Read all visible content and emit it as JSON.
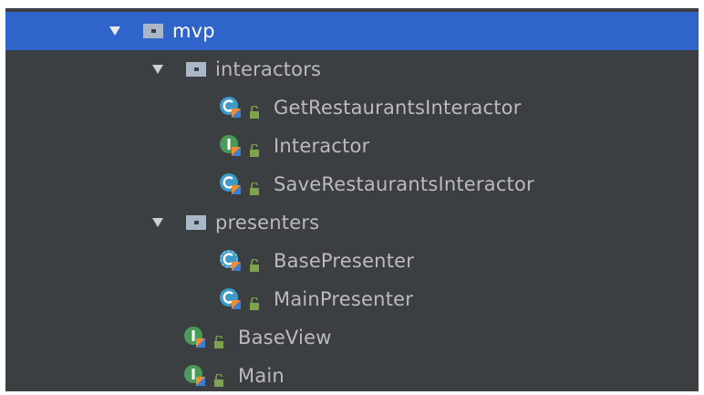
{
  "colors": {
    "panel_bg": "#3c3f41",
    "selection": "#2f65ca",
    "text": "#bbbbbb",
    "class_icon_blue": "#3d9ac7",
    "interface_icon_green": "#4a9a5a",
    "kotlin_badge": "#f08d33",
    "kotlin_badge_blue": "#3b7fd6",
    "lock_green": "#7ea34b"
  },
  "tree": {
    "mvp": {
      "label": "mvp",
      "icon": "folder-icon",
      "expanded": true,
      "selected": true
    },
    "interactors": {
      "label": "interactors",
      "icon": "folder-icon",
      "expanded": true
    },
    "get_restaurants_interactor": {
      "label": "GetRestaurantsInteractor",
      "icon": "kotlin-class-icon"
    },
    "interactor": {
      "label": "Interactor",
      "icon": "kotlin-interface-icon"
    },
    "save_restaurants_interactor": {
      "label": "SaveRestaurantsInteractor",
      "icon": "kotlin-class-icon"
    },
    "presenters": {
      "label": "presenters",
      "icon": "folder-icon",
      "expanded": true
    },
    "base_presenter": {
      "label": "BasePresenter",
      "icon": "kotlin-abstract-class-icon"
    },
    "main_presenter": {
      "label": "MainPresenter",
      "icon": "kotlin-class-icon"
    },
    "base_view": {
      "label": "BaseView",
      "icon": "kotlin-interface-icon"
    },
    "main": {
      "label": "Main",
      "icon": "kotlin-interface-icon"
    }
  }
}
